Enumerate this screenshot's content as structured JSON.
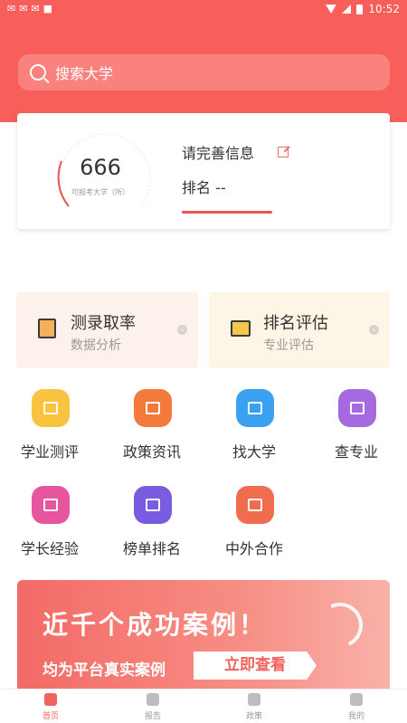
{
  "status_bar": {
    "left_icons": [
      "notification-icon",
      "notification-icon",
      "notification-icon",
      "android-icon"
    ],
    "time": "10:52"
  },
  "search": {
    "placeholder": "搜索大学"
  },
  "rank_card": {
    "score": "666",
    "score_caption": "可报考大学（所）",
    "prompt": "请完善信息",
    "rank_label": "排名 --"
  },
  "features": [
    {
      "title": "测录取率",
      "subtitle": "数据分析",
      "icon": "edit-doc-icon",
      "color": "#fdf1ec"
    },
    {
      "title": "排名评估",
      "subtitle": "专业评估",
      "icon": "bar-chart-icon",
      "color": "#fdf6e6"
    }
  ],
  "grid": [
    {
      "label": "学业测评",
      "icon": "chart-line-icon",
      "color": "#f9c33f"
    },
    {
      "label": "政策资讯",
      "icon": "document-icon",
      "color": "#f47a3c"
    },
    {
      "label": "找大学",
      "icon": "university-icon",
      "color": "#3aa1f0"
    },
    {
      "label": "查专业",
      "icon": "graduation-cap-icon",
      "color": "#a56ae0"
    },
    {
      "label": "学长经验",
      "icon": "badge-star-icon",
      "color": "#e8559f"
    },
    {
      "label": "榜单排名",
      "icon": "medal-icon",
      "color": "#7a5ce0"
    },
    {
      "label": "中外合作",
      "icon": "handshake-icon",
      "color": "#ef6c4f"
    }
  ],
  "banner": {
    "headline": "近千个成功案例！",
    "subtext": "均为平台真实案例",
    "button": "立即查看"
  },
  "tabbar": [
    {
      "label": "首页",
      "icon": "home-icon",
      "active": true
    },
    {
      "label": "报告",
      "icon": "report-icon",
      "active": false
    },
    {
      "label": "政策",
      "icon": "policy-icon",
      "active": false
    },
    {
      "label": "我的",
      "icon": "profile-icon",
      "active": false
    }
  ],
  "colors": {
    "brand": "#f85f5a",
    "accent": "#f2615c",
    "text": "#333333",
    "muted": "#999999"
  }
}
